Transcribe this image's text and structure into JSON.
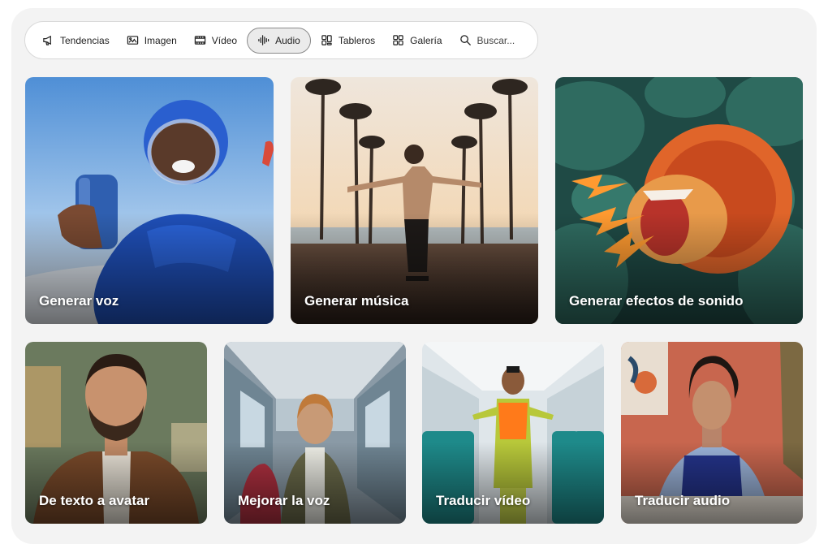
{
  "nav": {
    "items": [
      {
        "label": "Tendencias",
        "icon": "megaphone-icon"
      },
      {
        "label": "Imagen",
        "icon": "image-icon"
      },
      {
        "label": "Vídeo",
        "icon": "film-icon"
      },
      {
        "label": "Audio",
        "icon": "waveform-icon",
        "active": true
      },
      {
        "label": "Tableros",
        "icon": "boards-icon"
      },
      {
        "label": "Galería",
        "icon": "gallery-icon"
      }
    ],
    "search": {
      "label": "Buscar...",
      "icon": "search-icon"
    }
  },
  "cards": [
    {
      "label": "Generar voz"
    },
    {
      "label": "Generar música"
    },
    {
      "label": "Generar efectos de sonido"
    },
    {
      "label": "De texto a avatar"
    },
    {
      "label": "Mejorar la voz"
    },
    {
      "label": "Traducir vídeo"
    },
    {
      "label": "Traducir audio"
    }
  ],
  "colors": {
    "background": "#f3f3f3",
    "nav_active_bg": "#ebebeb",
    "label_text": "#ffffff"
  }
}
